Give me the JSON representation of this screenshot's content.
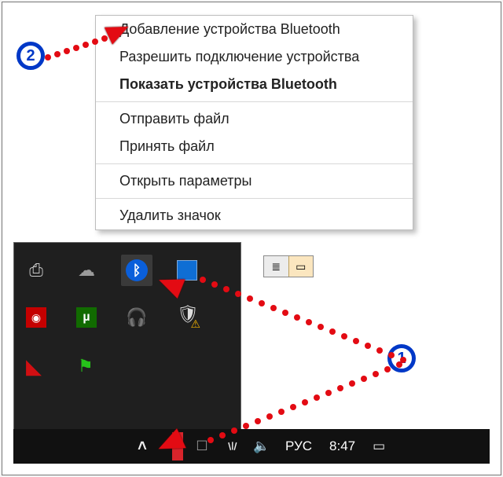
{
  "context_menu": {
    "items": [
      {
        "label": "Добавление устройства Bluetooth",
        "bold": false
      },
      {
        "label": "Разрешить подключение устройства",
        "bold": false
      },
      {
        "label": "Показать устройства Bluetooth",
        "bold": true
      }
    ],
    "items2": [
      {
        "label": "Отправить файл"
      },
      {
        "label": "Принять файл"
      }
    ],
    "items3": [
      {
        "label": "Открыть параметры"
      }
    ],
    "items4": [
      {
        "label": "Удалить значок"
      }
    ]
  },
  "tray_icons": {
    "row1": [
      "usb-icon",
      "cloud-icon",
      "bluetooth-icon",
      "intel-icon"
    ],
    "row2": [
      "camera-icon",
      "utorrent-icon",
      "headset-icon",
      "security-shield-icon"
    ],
    "row3": [
      "warning-flag-icon",
      "green-flag-icon"
    ]
  },
  "taskbar": {
    "chevron": "˄",
    "language": "РУС",
    "clock": "8:47"
  },
  "callouts": {
    "badge1": "1",
    "badge2": "2"
  }
}
